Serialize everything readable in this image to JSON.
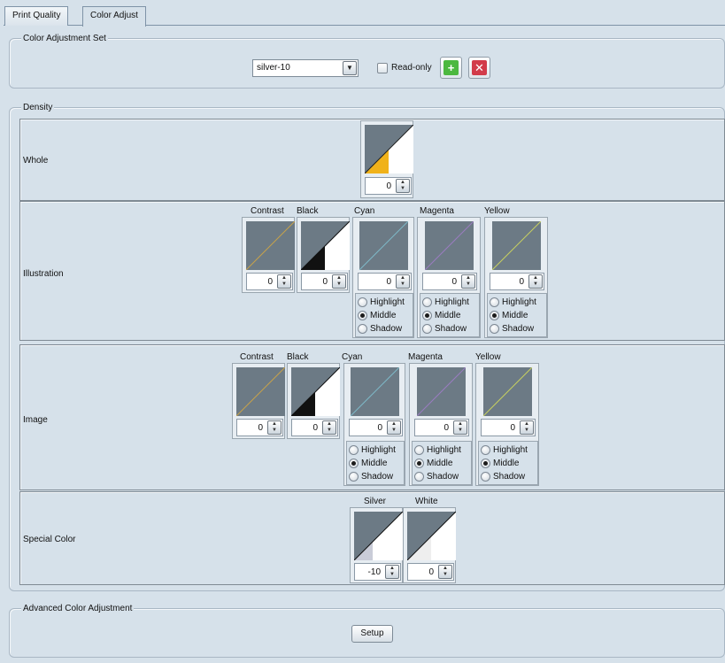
{
  "tabs": [
    {
      "label": "Print Quality",
      "active": false
    },
    {
      "label": "Color Adjust",
      "active": true
    }
  ],
  "color_set": {
    "group_title": "Color Adjustment Set",
    "selected": "silver-10",
    "readonly_label": "Read-only",
    "readonly_checked": false,
    "add_icon": "plus-icon",
    "delete_icon": "x-icon",
    "add_color": "#4cb840",
    "delete_color": "#d23b4a"
  },
  "density": {
    "group_title": "Density",
    "whole": {
      "label": "Whole",
      "value": "0",
      "fill_color": "#f0b21a"
    },
    "illustration": {
      "label": "Illustration",
      "columns": [
        {
          "label": "Contrast",
          "value": "0",
          "line_color": "#c8a24a"
        },
        {
          "label": "Black",
          "value": "0",
          "line_color": "#111111"
        },
        {
          "label": "Cyan",
          "value": "0",
          "line_color": "#7fb8c8",
          "options": [
            "Highlight",
            "Middle",
            "Shadow"
          ],
          "selected": "Middle"
        },
        {
          "label": "Magenta",
          "value": "0",
          "line_color": "#9a7cc0",
          "options": [
            "Highlight",
            "Middle",
            "Shadow"
          ],
          "selected": "Middle"
        },
        {
          "label": "Yellow",
          "value": "0",
          "line_color": "#c8d060",
          "options": [
            "Highlight",
            "Middle",
            "Shadow"
          ],
          "selected": "Middle"
        }
      ]
    },
    "image": {
      "label": "Image",
      "columns": [
        {
          "label": "Contrast",
          "value": "0",
          "line_color": "#c8a24a"
        },
        {
          "label": "Black",
          "value": "0",
          "line_color": "#111111"
        },
        {
          "label": "Cyan",
          "value": "0",
          "line_color": "#7fb8c8",
          "options": [
            "Highlight",
            "Middle",
            "Shadow"
          ],
          "selected": "Middle"
        },
        {
          "label": "Magenta",
          "value": "0",
          "line_color": "#9a7cc0",
          "options": [
            "Highlight",
            "Middle",
            "Shadow"
          ],
          "selected": "Middle"
        },
        {
          "label": "Yellow",
          "value": "0",
          "line_color": "#c8d060",
          "options": [
            "Highlight",
            "Middle",
            "Shadow"
          ],
          "selected": "Middle"
        }
      ]
    },
    "special": {
      "label": "Special Color",
      "columns": [
        {
          "label": "Silver",
          "value": "-10",
          "fill_color": "#c9ccd8"
        },
        {
          "label": "White",
          "value": "0",
          "fill_color": "#eeeeee"
        }
      ]
    }
  },
  "advanced": {
    "group_title": "Advanced Color Adjustment",
    "setup_label": "Setup"
  }
}
